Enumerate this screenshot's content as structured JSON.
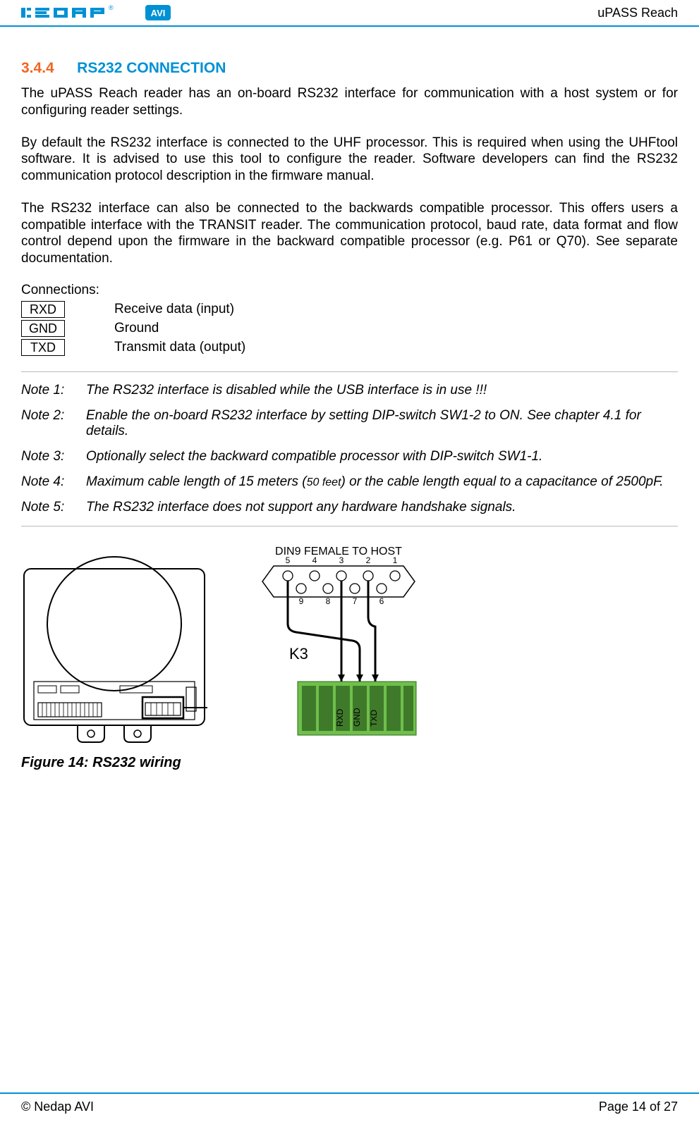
{
  "header": {
    "doc_title": "uPASS Reach",
    "logo_brand": "nedap",
    "logo_badge": "AVI"
  },
  "section": {
    "number": "3.4.4",
    "title": "RS232 CONNECTION"
  },
  "paragraphs": {
    "p1": "The uPASS Reach reader has an on-board RS232 interface for communication with a host system or for configuring reader settings.",
    "p2": "By default the RS232 interface is connected to the UHF processor. This is required when using the UHFtool software. It is advised to use this tool to configure the reader. Software developers can find the RS232 communication protocol description in the firmware manual.",
    "p3": "The RS232 interface can also be connected to the backwards compatible processor. This offers users a compatible interface with the TRANSIT reader. The communication protocol, baud rate, data format and flow control depend upon the firmware in the backward compatible processor (e.g. P61 or Q70). See separate documentation."
  },
  "connections": {
    "label": "Connections:",
    "rows": [
      {
        "pin": "RXD",
        "desc": "Receive data (input)"
      },
      {
        "pin": "GND",
        "desc": "Ground"
      },
      {
        "pin": "TXD",
        "desc": "Transmit data (output)"
      }
    ]
  },
  "notes": [
    {
      "label": "Note 1:",
      "text": "The RS232 interface is disabled while the USB interface is in use !!!"
    },
    {
      "label": "Note 2:",
      "text": "Enable the on-board RS232 interface by setting DIP-switch SW1-2 to ON. See chapter 4.1 for details."
    },
    {
      "label": "Note 3:",
      "text": "Optionally select the backward compatible processor with DIP-switch SW1-1."
    },
    {
      "label": "Note 4:",
      "text_a": "Maximum cable length of 15 meters (",
      "text_small": "50 feet",
      "text_b": ") or the cable length equal to a capacitance of 2500pF."
    },
    {
      "label": "Note 5:",
      "text": "The RS232 interface does not support any hardware handshake signals."
    }
  ],
  "figure": {
    "caption": "Figure 14: RS232 wiring",
    "connector_title": "DIN9 FEMALE TO HOST",
    "connector_label": "K3",
    "pins_top": [
      "5",
      "4",
      "3",
      "2",
      "1"
    ],
    "pins_bot": [
      "9",
      "8",
      "7",
      "6"
    ],
    "terminal_labels": [
      "RXD",
      "GND",
      "TXD"
    ]
  },
  "footer": {
    "left": "© Nedap AVI",
    "right": "Page 14 of 27"
  }
}
